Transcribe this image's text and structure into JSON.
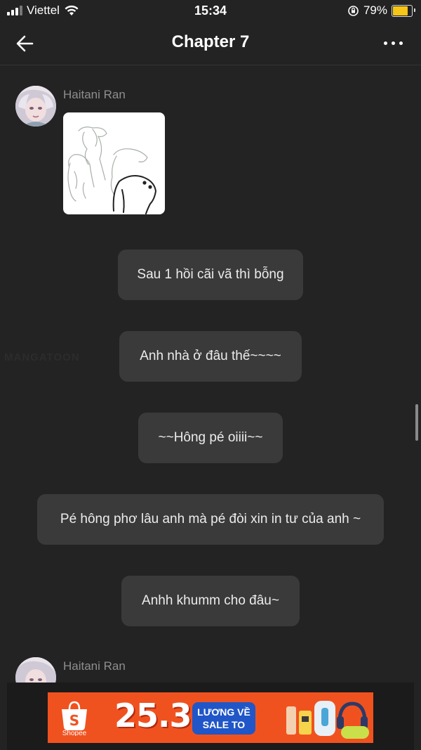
{
  "status_bar": {
    "carrier": "Viettel",
    "time": "15:34",
    "battery": "79%",
    "battery_level": 0.79,
    "signal_bars": 3,
    "signal_total": 4
  },
  "header": {
    "title": "Chapter 7",
    "back_icon": "arrow-left-icon",
    "more_icon": "more-horizontal-icon"
  },
  "chat": {
    "sender_top": "Haitani Ran",
    "sender_bottom": "Haitani Ran",
    "messages": [
      "Sau 1 hồi cãi vã thì bỗng",
      "Anh nhà ở đâu thế~~~~",
      "~~Hông pé oiiii~~",
      "Pé hông phơ lâu anh mà pé đòi xin in tư của anh ~",
      "Anhh khumm cho đâu~"
    ],
    "watermark": "MANGATOON"
  },
  "ad": {
    "brand": "Shopee",
    "date": "25.3",
    "tag_line1": "LƯƠNG VỀ",
    "tag_line2": "SALE TO",
    "accent": "#f0521f"
  },
  "colors": {
    "background": "#232323",
    "bubble": "#3a3a3a",
    "battery": "#f5c518"
  }
}
